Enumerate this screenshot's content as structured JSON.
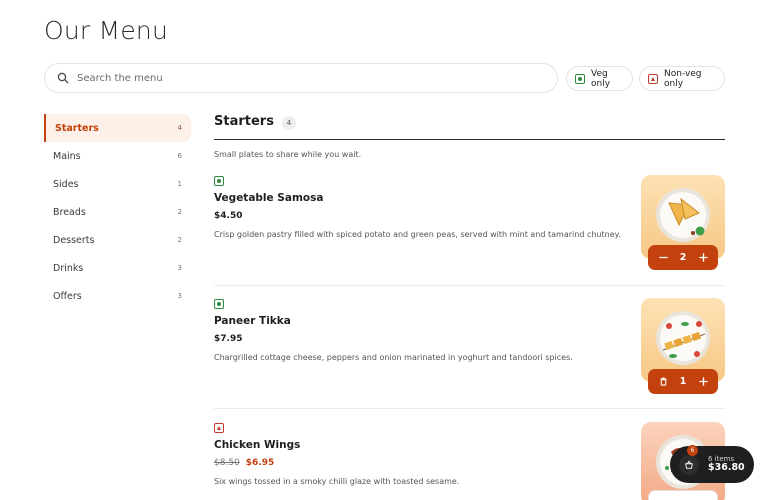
{
  "page": {
    "title": "Our Menu"
  },
  "search": {
    "placeholder": "Search the menu",
    "value": ""
  },
  "filters": {
    "veg_label": "Veg only",
    "nonveg_label": "Non-veg only"
  },
  "sidebar": {
    "items": [
      {
        "label": "Starters",
        "count": "4",
        "active": true
      },
      {
        "label": "Mains",
        "count": "6"
      },
      {
        "label": "Sides",
        "count": "1"
      },
      {
        "label": "Breads",
        "count": "2"
      },
      {
        "label": "Desserts",
        "count": "2"
      },
      {
        "label": "Drinks",
        "count": "3"
      },
      {
        "label": "Offers",
        "count": "3"
      }
    ]
  },
  "section": {
    "title": "Starters",
    "count": "4",
    "description": "Small plates to share while you wait."
  },
  "items": [
    {
      "type": "veg",
      "name": "Vegetable Samosa",
      "price": "$4.50",
      "description": "Crisp golden pastry filled with spiced potato and green peas, served with mint and tamarind chutney.",
      "quantity": "2",
      "thumb_icon": "samosa-plate"
    },
    {
      "type": "veg",
      "name": "Paneer Tikka",
      "price": "$7.95",
      "description": "Chargrilled cottage cheese, peppers and onion marinated in yoghurt and tandoori spices.",
      "quantity": "1",
      "thumb_icon": "paneer-skewer-plate"
    },
    {
      "type": "nonveg",
      "name": "Chicken Wings",
      "old_price": "$8.50",
      "price": "$6.95",
      "description": "Six wings tossed in a smoky chilli glaze with toasted sesame.",
      "thumb_icon": "wings-plate"
    }
  ],
  "cart": {
    "badge": "6",
    "count_label": "6 items",
    "total": "$36.80"
  },
  "colors": {
    "accent": "#c2410c",
    "veg": "#2e8a3e",
    "nonveg": "#c0392b",
    "dark": "#1f1f1f"
  }
}
